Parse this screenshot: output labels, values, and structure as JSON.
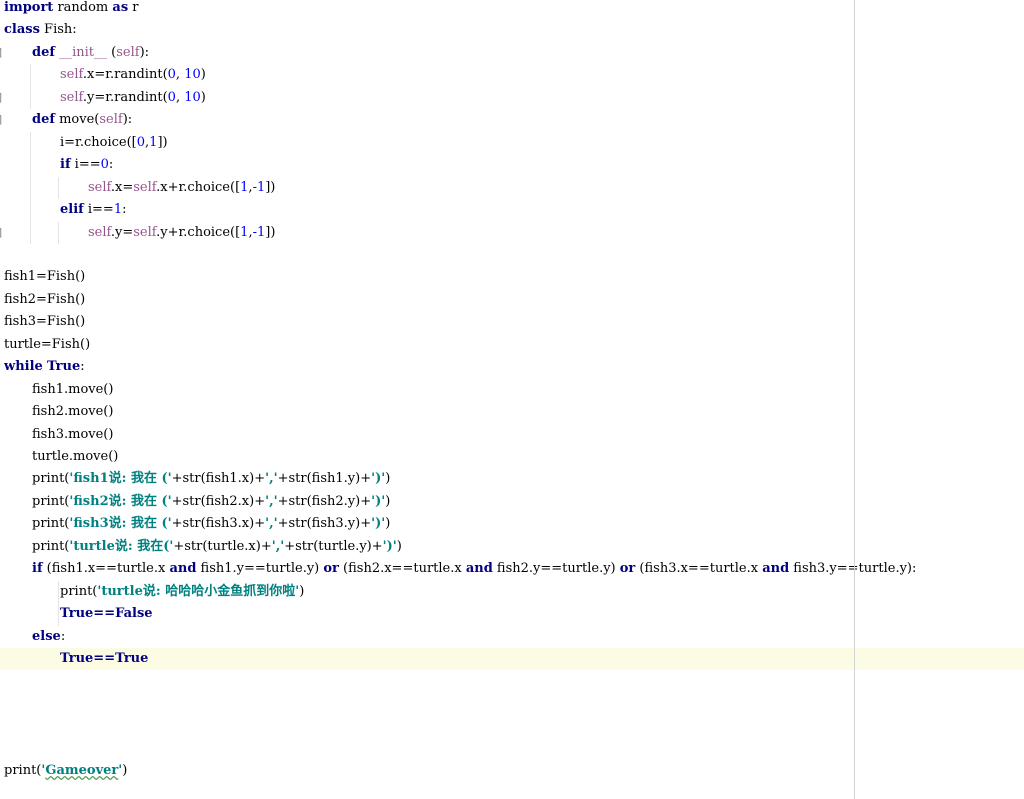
{
  "editor": {
    "language": "python",
    "current_line_index": 29,
    "lines": [
      {
        "indent": 0,
        "marker": "",
        "tokens": [
          [
            "kw",
            "import"
          ],
          [
            "t",
            " random "
          ],
          [
            "kw",
            "as"
          ],
          [
            "t",
            " r"
          ]
        ]
      },
      {
        "indent": 0,
        "marker": "",
        "tokens": [
          [
            "kw",
            "class"
          ],
          [
            "t",
            " Fish:"
          ]
        ]
      },
      {
        "indent": 1,
        "marker": "]",
        "tokens": [
          [
            "kw",
            "def"
          ],
          [
            "t",
            " "
          ],
          [
            "self",
            "__init__"
          ],
          [
            "t",
            " ("
          ],
          [
            "self",
            "self"
          ],
          [
            "t",
            "):"
          ]
        ]
      },
      {
        "indent": 2,
        "marker": "",
        "tokens": [
          [
            "self",
            "self"
          ],
          [
            "t",
            ".x=r.randint("
          ],
          [
            "num",
            "0"
          ],
          [
            "t",
            ", "
          ],
          [
            "num",
            "10"
          ],
          [
            "t",
            ")"
          ]
        ]
      },
      {
        "indent": 2,
        "marker": "]",
        "tokens": [
          [
            "self",
            "self"
          ],
          [
            "t",
            ".y=r.randint("
          ],
          [
            "num",
            "0"
          ],
          [
            "t",
            ", "
          ],
          [
            "num",
            "10"
          ],
          [
            "t",
            ")"
          ]
        ]
      },
      {
        "indent": 1,
        "marker": "]",
        "tokens": [
          [
            "kw",
            "def"
          ],
          [
            "t",
            " move("
          ],
          [
            "self",
            "self"
          ],
          [
            "t",
            "):"
          ]
        ]
      },
      {
        "indent": 2,
        "marker": "",
        "tokens": [
          [
            "t",
            "i=r.choice(["
          ],
          [
            "num",
            "0"
          ],
          [
            "t",
            ","
          ],
          [
            "num",
            "1"
          ],
          [
            "t",
            "])"
          ]
        ]
      },
      {
        "indent": 2,
        "marker": "",
        "tokens": [
          [
            "kw",
            "if"
          ],
          [
            "t",
            " i=="
          ],
          [
            "num",
            "0"
          ],
          [
            "t",
            ":"
          ]
        ]
      },
      {
        "indent": 3,
        "marker": "",
        "tokens": [
          [
            "self",
            "self"
          ],
          [
            "t",
            ".x="
          ],
          [
            "self",
            "self"
          ],
          [
            "t",
            ".x+r.choice(["
          ],
          [
            "num",
            "1"
          ],
          [
            "t",
            ","
          ],
          [
            "num",
            "-1"
          ],
          [
            "t",
            "])"
          ]
        ]
      },
      {
        "indent": 2,
        "marker": "",
        "tokens": [
          [
            "kw",
            "elif"
          ],
          [
            "t",
            " i=="
          ],
          [
            "num",
            "1"
          ],
          [
            "t",
            ":"
          ]
        ]
      },
      {
        "indent": 3,
        "marker": "]",
        "tokens": [
          [
            "self",
            "self"
          ],
          [
            "t",
            ".y="
          ],
          [
            "self",
            "self"
          ],
          [
            "t",
            ".y+r.choice(["
          ],
          [
            "num",
            "1"
          ],
          [
            "t",
            ","
          ],
          [
            "num",
            "-1"
          ],
          [
            "t",
            "])"
          ]
        ]
      },
      {
        "indent": 0,
        "marker": "",
        "tokens": []
      },
      {
        "indent": 0,
        "marker": "",
        "tokens": [
          [
            "t",
            "fish1=Fish()"
          ]
        ]
      },
      {
        "indent": 0,
        "marker": "",
        "tokens": [
          [
            "t",
            "fish2=Fish()"
          ]
        ]
      },
      {
        "indent": 0,
        "marker": "",
        "tokens": [
          [
            "t",
            "fish3=Fish()"
          ]
        ]
      },
      {
        "indent": 0,
        "marker": "",
        "tokens": [
          [
            "t",
            "turtle=Fish()"
          ]
        ]
      },
      {
        "indent": 0,
        "marker": "",
        "tokens": [
          [
            "kw",
            "while"
          ],
          [
            "t",
            " "
          ],
          [
            "kw",
            "True"
          ],
          [
            "t",
            ":"
          ]
        ]
      },
      {
        "indent": 1,
        "marker": "",
        "tokens": [
          [
            "t",
            "fish1.move()"
          ]
        ]
      },
      {
        "indent": 1,
        "marker": "",
        "tokens": [
          [
            "t",
            "fish2.move()"
          ]
        ]
      },
      {
        "indent": 1,
        "marker": "",
        "tokens": [
          [
            "t",
            "fish3.move()"
          ]
        ]
      },
      {
        "indent": 1,
        "marker": "",
        "tokens": [
          [
            "t",
            "turtle.move()"
          ]
        ]
      },
      {
        "indent": 1,
        "marker": "",
        "tokens": [
          [
            "t",
            "print("
          ],
          [
            "str",
            "'fish1说: 我在 ('"
          ],
          [
            "t",
            "+str(fish1.x)+"
          ],
          [
            "str",
            "','"
          ],
          [
            "t",
            "+str(fish1.y)+"
          ],
          [
            "str",
            "')'"
          ],
          [
            "t",
            ")"
          ]
        ]
      },
      {
        "indent": 1,
        "marker": "",
        "tokens": [
          [
            "t",
            "print("
          ],
          [
            "str",
            "'fish2说: 我在 ('"
          ],
          [
            "t",
            "+str(fish2.x)+"
          ],
          [
            "str",
            "','"
          ],
          [
            "t",
            "+str(fish2.y)+"
          ],
          [
            "str",
            "')'"
          ],
          [
            "t",
            ")"
          ]
        ]
      },
      {
        "indent": 1,
        "marker": "",
        "tokens": [
          [
            "t",
            "print("
          ],
          [
            "str",
            "'fish3说: 我在 ('"
          ],
          [
            "t",
            "+str(fish3.x)+"
          ],
          [
            "str",
            "','"
          ],
          [
            "t",
            "+str(fish3.y)+"
          ],
          [
            "str",
            "')'"
          ],
          [
            "t",
            ")"
          ]
        ]
      },
      {
        "indent": 1,
        "marker": "",
        "tokens": [
          [
            "t",
            "print("
          ],
          [
            "str",
            "'turtle说: 我在('"
          ],
          [
            "t",
            "+str(turtle.x)+"
          ],
          [
            "str",
            "','"
          ],
          [
            "t",
            "+str(turtle.y)+"
          ],
          [
            "str",
            "')'"
          ],
          [
            "t",
            ")"
          ]
        ]
      },
      {
        "indent": 1,
        "marker": "",
        "tokens": [
          [
            "kw",
            "if"
          ],
          [
            "t",
            " (fish1.x==turtle.x "
          ],
          [
            "kw",
            "and"
          ],
          [
            "t",
            " fish1.y==turtle.y) "
          ],
          [
            "kw",
            "or"
          ],
          [
            "t",
            " (fish2.x==turtle.x "
          ],
          [
            "kw",
            "and"
          ],
          [
            "t",
            " fish2.y==turtle.y) "
          ],
          [
            "kw",
            "or"
          ],
          [
            "t",
            " (fish3.x==turtle.x "
          ],
          [
            "kw",
            "and"
          ],
          [
            "t",
            " fish3.y==turtle.y):"
          ]
        ]
      },
      {
        "indent": 2,
        "marker": "",
        "tokens": [
          [
            "t",
            "print("
          ],
          [
            "str",
            "'turtle说: 哈哈哈小金鱼抓到你啦'"
          ],
          [
            "t",
            ")"
          ]
        ]
      },
      {
        "indent": 2,
        "marker": "",
        "tokens": [
          [
            "kw",
            "True==False"
          ]
        ]
      },
      {
        "indent": 1,
        "marker": "",
        "tokens": [
          [
            "kw",
            "else"
          ],
          [
            "t",
            ":"
          ]
        ]
      },
      {
        "indent": 2,
        "marker": "",
        "tokens": [
          [
            "kw",
            "True==True"
          ]
        ]
      },
      {
        "indent": 0,
        "marker": "",
        "tokens": []
      },
      {
        "indent": 0,
        "marker": "",
        "tokens": []
      },
      {
        "indent": 0,
        "marker": "",
        "tokens": []
      },
      {
        "indent": 0,
        "marker": "",
        "tokens": []
      },
      {
        "indent": 0,
        "marker": "",
        "tokens": [
          [
            "t",
            "print("
          ],
          [
            "str",
            "'"
          ],
          [
            "warn",
            "Gameover"
          ],
          [
            "str",
            "'"
          ],
          [
            "t",
            ")"
          ]
        ]
      }
    ]
  }
}
